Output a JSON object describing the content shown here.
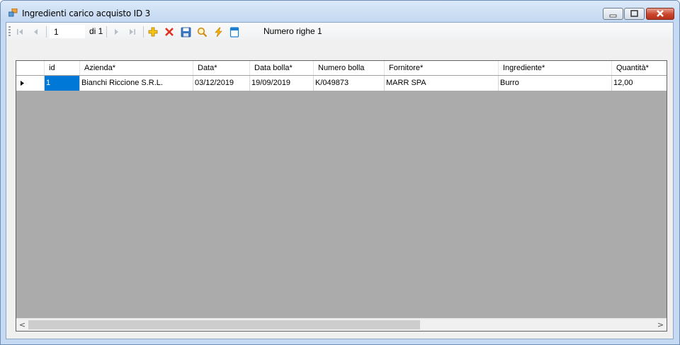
{
  "window": {
    "title": "Ingredienti carico acquisto ID 3",
    "icon": "app-window-icon",
    "controls": [
      "minimize-icon",
      "maximize-icon",
      "close-icon"
    ]
  },
  "navigator": {
    "position": "1",
    "of_count": "di 1",
    "buttons": [
      "first-icon",
      "previous-icon",
      "next-icon",
      "last-icon",
      "add-icon",
      "delete-icon",
      "save-icon",
      "search-icon",
      "lightning-icon",
      "document-icon"
    ],
    "row_count_label": "Numero righe 1"
  },
  "grid": {
    "columns": [
      "id",
      "Azienda*",
      "Data*",
      "Data bolla*",
      "Numero bolla",
      "Fornitore*",
      "Ingrediente*",
      "Quantità*"
    ],
    "rows": [
      [
        "1",
        "Bianchi Riccione S.R.L.",
        "03/12/2019",
        "19/09/2019",
        "K/049873",
        "MARR SPA",
        "Burro",
        "12,00"
      ]
    ],
    "scroll_left": "<",
    "scroll_right": ">"
  },
  "colors": {
    "selected_cell": "#0078d7",
    "grid_background": "#ababab",
    "window_frame": "#c6dbf3"
  }
}
